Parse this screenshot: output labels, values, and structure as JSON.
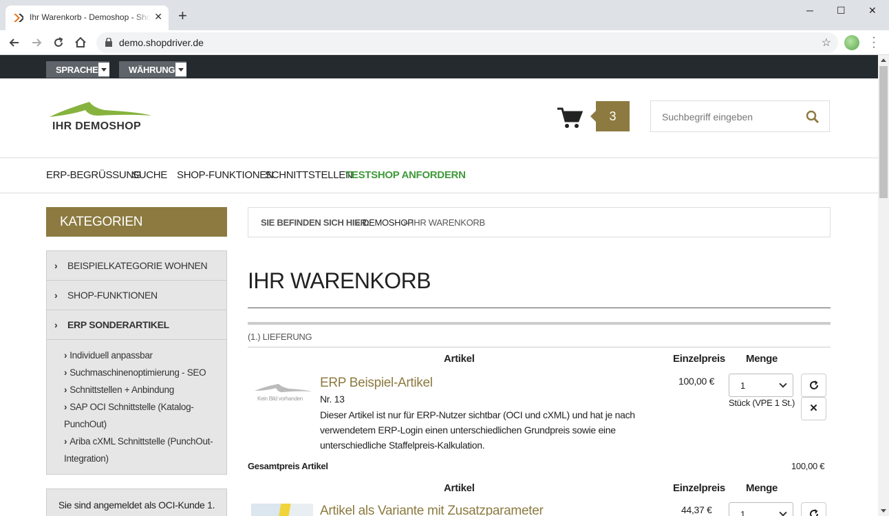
{
  "browser": {
    "tab_title": "Ihr Warenkorb - Demoshop - Shopdriver",
    "new_tab": "+",
    "url": "demo.shopdriver.de",
    "win_min": "─",
    "win_max": "☐",
    "win_close": "✕"
  },
  "topbar": {
    "language_label": "SPRACHE",
    "currency_label": "WÄHRUNG"
  },
  "header": {
    "logo_text": "IHR DEMOSHOP",
    "cart_count": "3",
    "search_placeholder": "Suchbegriff eingeben",
    "brand_color": "#8c7a40"
  },
  "mainnav": {
    "items": [
      "ERP-BEGRÜSSUNG",
      "SUCHE",
      "SHOP-FUNKTIONEN",
      "SCHNITTSTELLEN",
      "TESTSHOP ANFORDERN"
    ],
    "highlight_color": "#3f9a3a"
  },
  "sidebar": {
    "heading": "KATEGORIEN",
    "categories": [
      "BEISPIELKATEGORIE WOHNEN",
      "SHOP-FUNKTIONEN",
      "ERP SONDERARTIKEL"
    ],
    "subcategories": [
      "Individuell anpassbar",
      "Suchmaschinenoptimierung - SEO",
      "Schnittstellen + Anbindung",
      "SAP OCI Schnittstelle (Katalog-PunchOut)",
      "Ariba cXML Schnittstelle (PunchOut-Integration)"
    ],
    "login_text": "Sie sind angemeldet als OCI-Kunde 1."
  },
  "breadcrumb": {
    "label": "SIE BEFINDEN SICH HIER:",
    "sep": "»",
    "home": "DEMOSHOP",
    "current": "IHR WARENKORB"
  },
  "cart": {
    "title": "IHR WARENKORB",
    "delivery": "(1.) LIEFERUNG",
    "columns": {
      "article": "Artikel",
      "unit_price": "Einzelpreis",
      "quantity": "Menge"
    },
    "items": [
      {
        "image_alt": "Kein Bild vorhanden",
        "name": "ERP Beispiel-Artikel",
        "number": "Nr. 13",
        "description": "Dieser Artikel ist nur für ERP-Nutzer sichtbar (OCI und cXML) und hat je nach verwendetem ERP-Login einen unterschiedlichen Grundpreis sowie eine unterschiedliche Staffelpreis-Kalkulation.",
        "price": "100,00 €",
        "qty": "1",
        "unit": "Stück (VPE 1 St.)"
      },
      {
        "name": "Artikel als Variante mit Zusatzparameter",
        "price": "44,37 €",
        "qty": "1"
      }
    ],
    "total_label": "Gesamtpreis Artikel",
    "total_value": "100,00 €"
  }
}
